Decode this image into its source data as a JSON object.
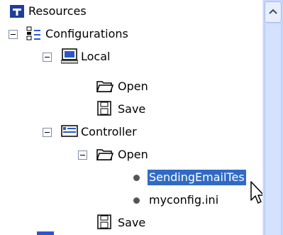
{
  "tree": {
    "items": [
      {
        "label": "Resources",
        "icon": "app-logo-icon"
      },
      {
        "label": "Configurations",
        "icon": "configurations-icon"
      },
      {
        "label": "Local",
        "icon": "computer-icon"
      },
      {
        "label": "Open",
        "icon": "folder-open-icon"
      },
      {
        "label": "Save",
        "icon": "floppy-disk-icon"
      },
      {
        "label": "Controller",
        "icon": "controller-icon"
      },
      {
        "label": "Open",
        "icon": "folder-open-icon"
      },
      {
        "label": "SendingEmailTes",
        "icon": "bullet-icon",
        "selected": true
      },
      {
        "label": "myconfig.ini",
        "icon": "bullet-icon"
      },
      {
        "label": "Save",
        "icon": "floppy-disk-icon"
      }
    ]
  },
  "colors": {
    "selection": "#316ac5",
    "scrollbar": "#c6d6ff",
    "logo": "#1d3f9a"
  }
}
